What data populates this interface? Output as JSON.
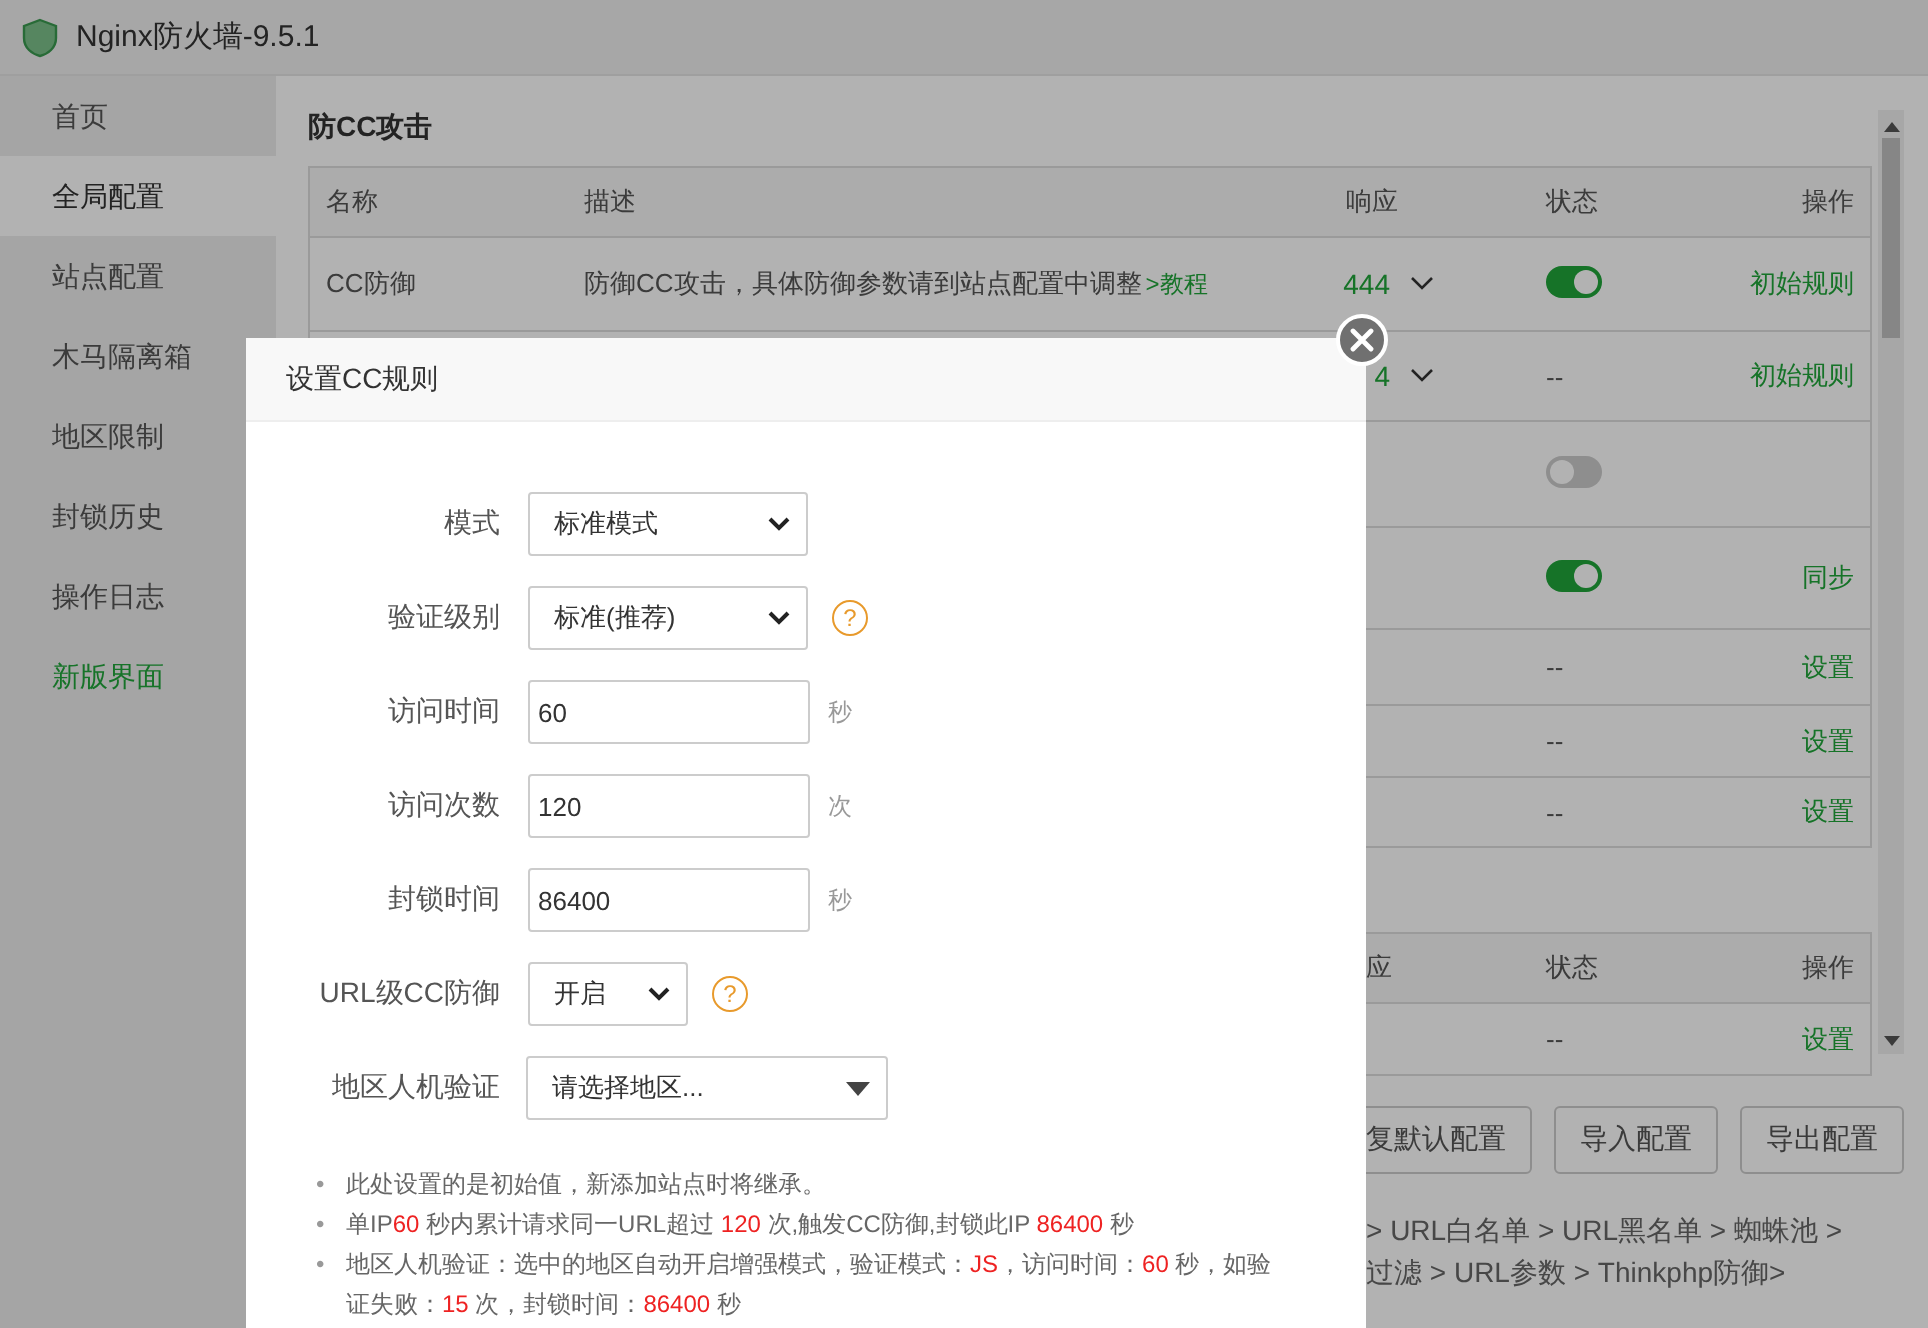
{
  "window": {
    "title": "Nginx防火墙-9.5.1"
  },
  "sidebar": {
    "items": [
      {
        "label": "首页",
        "selected": false,
        "kind": "nav"
      },
      {
        "label": "全局配置",
        "selected": true,
        "kind": "nav"
      },
      {
        "label": "站点配置",
        "selected": false,
        "kind": "nav"
      },
      {
        "label": "木马隔离箱",
        "selected": false,
        "kind": "nav"
      },
      {
        "label": "地区限制",
        "selected": false,
        "kind": "nav"
      },
      {
        "label": "封锁历史",
        "selected": false,
        "kind": "nav"
      },
      {
        "label": "操作日志",
        "selected": false,
        "kind": "nav"
      },
      {
        "label": "新版界面",
        "selected": false,
        "kind": "link"
      }
    ]
  },
  "section": {
    "title": "防CC攻击",
    "table": {
      "columns": [
        "名称",
        "描述",
        "响应",
        "状态",
        "操作"
      ],
      "rows": [
        {
          "name": "CC防御",
          "description": "防御CC攻击，具体防御参数请到站点配置中调整",
          "link": ">教程",
          "response": "444",
          "status": {
            "kind": "toggle",
            "on": true
          },
          "action": "初始规则"
        },
        {
          "response": "4",
          "status": {
            "kind": "text",
            "text": "--"
          },
          "action": "初始规则"
        },
        {
          "status": {
            "kind": "toggle",
            "on": false
          }
        },
        {
          "status": {
            "kind": "toggle",
            "on": true
          },
          "action": "同步"
        },
        {
          "status": {
            "kind": "text",
            "text": "--"
          },
          "action": "设置"
        },
        {
          "status": {
            "kind": "text",
            "text": "--"
          },
          "action": "设置"
        },
        {
          "status": {
            "kind": "text",
            "text": "--"
          },
          "action": "设置"
        }
      ]
    }
  },
  "table_2": {
    "columns": [
      "应",
      "状态",
      "操作"
    ],
    "rows": [
      {
        "status": "--",
        "action": "设置"
      }
    ]
  },
  "buttons": [
    "复默认配置",
    "导入配置",
    "导出配置"
  ],
  "footer_links": [
    "> URL白名单 > URL黑名单 > 蜘蛛池 >",
    "过滤 > URL参数 > Thinkphp防御>"
  ],
  "dialog": {
    "title": "设置CC规则",
    "fields": [
      {
        "label": "模式",
        "kind": "select",
        "value": "标准模式"
      },
      {
        "label": "验证级别",
        "kind": "select",
        "value": "标准(推荐)",
        "help": "?"
      },
      {
        "label": "访问时间",
        "kind": "input",
        "value": "60",
        "unit": "秒"
      },
      {
        "label": "访问次数",
        "kind": "input",
        "value": "120",
        "unit": "次"
      },
      {
        "label": "封锁时间",
        "kind": "input",
        "value": "86400",
        "unit": "秒"
      },
      {
        "label": "URL级CC防御",
        "kind": "select",
        "value": "开启",
        "help": "?"
      },
      {
        "label": "地区人机验证",
        "kind": "multiselect",
        "placeholder": "请选择地区..."
      }
    ],
    "notes": [
      {
        "bullet": "•",
        "parts": [
          {
            "text": "此处设置的是初始值，新添加站点时将继承。",
            "highlight": false
          }
        ]
      },
      {
        "bullet": "•",
        "parts": [
          {
            "text": "单IP",
            "highlight": false
          },
          {
            "text": "60",
            "highlight": true
          },
          {
            "text": " 秒内累计请求同一URL超过 ",
            "highlight": false
          },
          {
            "text": "120",
            "highlight": true
          },
          {
            "text": " 次,触发CC防御,封锁此IP ",
            "highlight": false
          },
          {
            "text": "86400",
            "highlight": true
          },
          {
            "text": " 秒",
            "highlight": false
          }
        ]
      },
      {
        "bullet": "•",
        "parts": [
          {
            "text": "地区人机验证：选中的地区自动开启增强模式，验证模式：",
            "highlight": false
          },
          {
            "text": "JS",
            "highlight": true
          },
          {
            "text": "，访问时间：",
            "highlight": false
          },
          {
            "text": "60",
            "highlight": true
          },
          {
            "text": " 秒，如验证失败：",
            "highlight": false
          },
          {
            "text": "15",
            "highlight": true
          },
          {
            "text": " 次，封锁时间：",
            "highlight": false
          },
          {
            "text": "86400",
            "highlight": true
          },
          {
            "text": " 秒",
            "highlight": false
          }
        ]
      }
    ]
  }
}
